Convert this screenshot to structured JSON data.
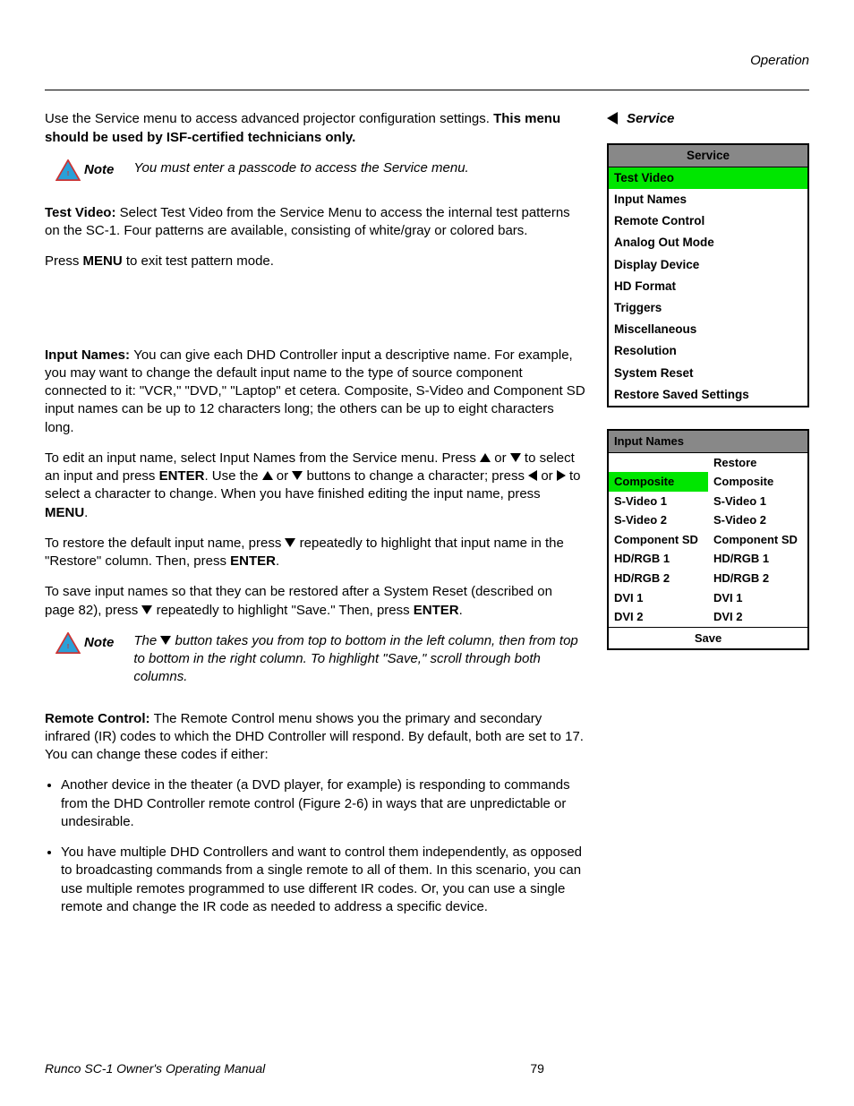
{
  "header": {
    "section": "Operation"
  },
  "serviceHeading": "Service",
  "intro": {
    "p1a": "Use the Service menu to access advanced projector configuration settings. ",
    "p1b": "This menu should be used by ISF-certified technicians only."
  },
  "note1": {
    "label": "Note",
    "text": "You must enter a passcode to access the Service menu."
  },
  "testVideo": {
    "label": "Test Video: ",
    "body": "Select Test Video from the Service Menu to access the internal test patterns on the SC-1. Four patterns are available, consisting of white/gray or colored bars.",
    "press1": "Press ",
    "menu": "MENU",
    "press2": " to exit test pattern mode."
  },
  "inputNames": {
    "label": "Input Names: ",
    "body": "You can give each DHD Controller input a descriptive name. For example, you may want to change the default input name to the type of source component connected to it: \"VCR,\" \"DVD,\" \"Laptop\" et cetera. Composite, S-Video and Component SD input names can be up to 12 characters long; the others can be up to eight characters long.",
    "edit": {
      "a": "To edit an input name, select Input Names from the Service menu. Press ",
      "b": " or ",
      "c": " to select an input and press ",
      "enter1": "ENTER",
      "d": ". Use the ",
      "e": " or ",
      "f": " buttons to change a character; press ",
      "g": " or ",
      "h": " to select a character to change. When you have finished editing the input name, press ",
      "menu": "MENU",
      "i": "."
    },
    "restore": {
      "a": "To restore the default input name, press ",
      "b": " repeatedly to highlight that input name in the \"Restore\" column. Then, press ",
      "enter": "ENTER",
      "c": "."
    },
    "save": {
      "a": "To save input names so that they can be restored after a System Reset (described on page 82), press ",
      "b": " repeatedly to highlight \"Save.\" Then, press ",
      "enter": "ENTER",
      "c": "."
    }
  },
  "note2": {
    "label": "Note",
    "a": "The ",
    "b": " button takes you from top to bottom in the left column, then from top to bottom in the right column. To highlight \"Save,\" scroll through both columns."
  },
  "remote": {
    "label": "Remote Control: ",
    "body": "The Remote Control menu shows you the primary and secondary infrared (IR) codes to which the DHD Controller will respond. By default, both are set to 17. You can change these codes if either:",
    "li1": "Another device in the theater (a DVD player, for example) is responding to commands from the DHD Controller remote control (Figure 2-6) in ways that are unpredictable or undesirable.",
    "li2": "You have multiple DHD Controllers and want to control them independently, as opposed to broadcasting commands from a single remote to all of them. In this scenario, you can use multiple remotes programmed to use different IR codes. Or, you can use a single remote and change the IR code as needed to address a specific device."
  },
  "serviceMenu": {
    "title": "Service",
    "items": [
      "Test Video",
      "Input Names",
      "Remote Control",
      "Analog Out Mode",
      "Display Device",
      "HD Format",
      "Triggers",
      "Miscellaneous",
      "Resolution",
      "System Reset",
      "Restore Saved Settings"
    ],
    "highlighted": "Test Video"
  },
  "inputMenu": {
    "title": "Input Names",
    "restoreHeader": "Restore",
    "rows": [
      {
        "l": "Composite",
        "r": "Composite",
        "hl": true
      },
      {
        "l": "S-Video 1",
        "r": "S-Video 1"
      },
      {
        "l": "S-Video 2",
        "r": "S-Video 2"
      },
      {
        "l": "Component SD",
        "r": "Component SD"
      },
      {
        "l": "HD/RGB 1",
        "r": "HD/RGB 1"
      },
      {
        "l": "HD/RGB 2",
        "r": "HD/RGB 2"
      },
      {
        "l": "DVI 1",
        "r": "DVI 1"
      },
      {
        "l": "DVI 2",
        "r": "DVI 2"
      }
    ],
    "save": "Save"
  },
  "footer": {
    "title": "Runco SC-1 Owner's Operating Manual",
    "page": "79"
  }
}
